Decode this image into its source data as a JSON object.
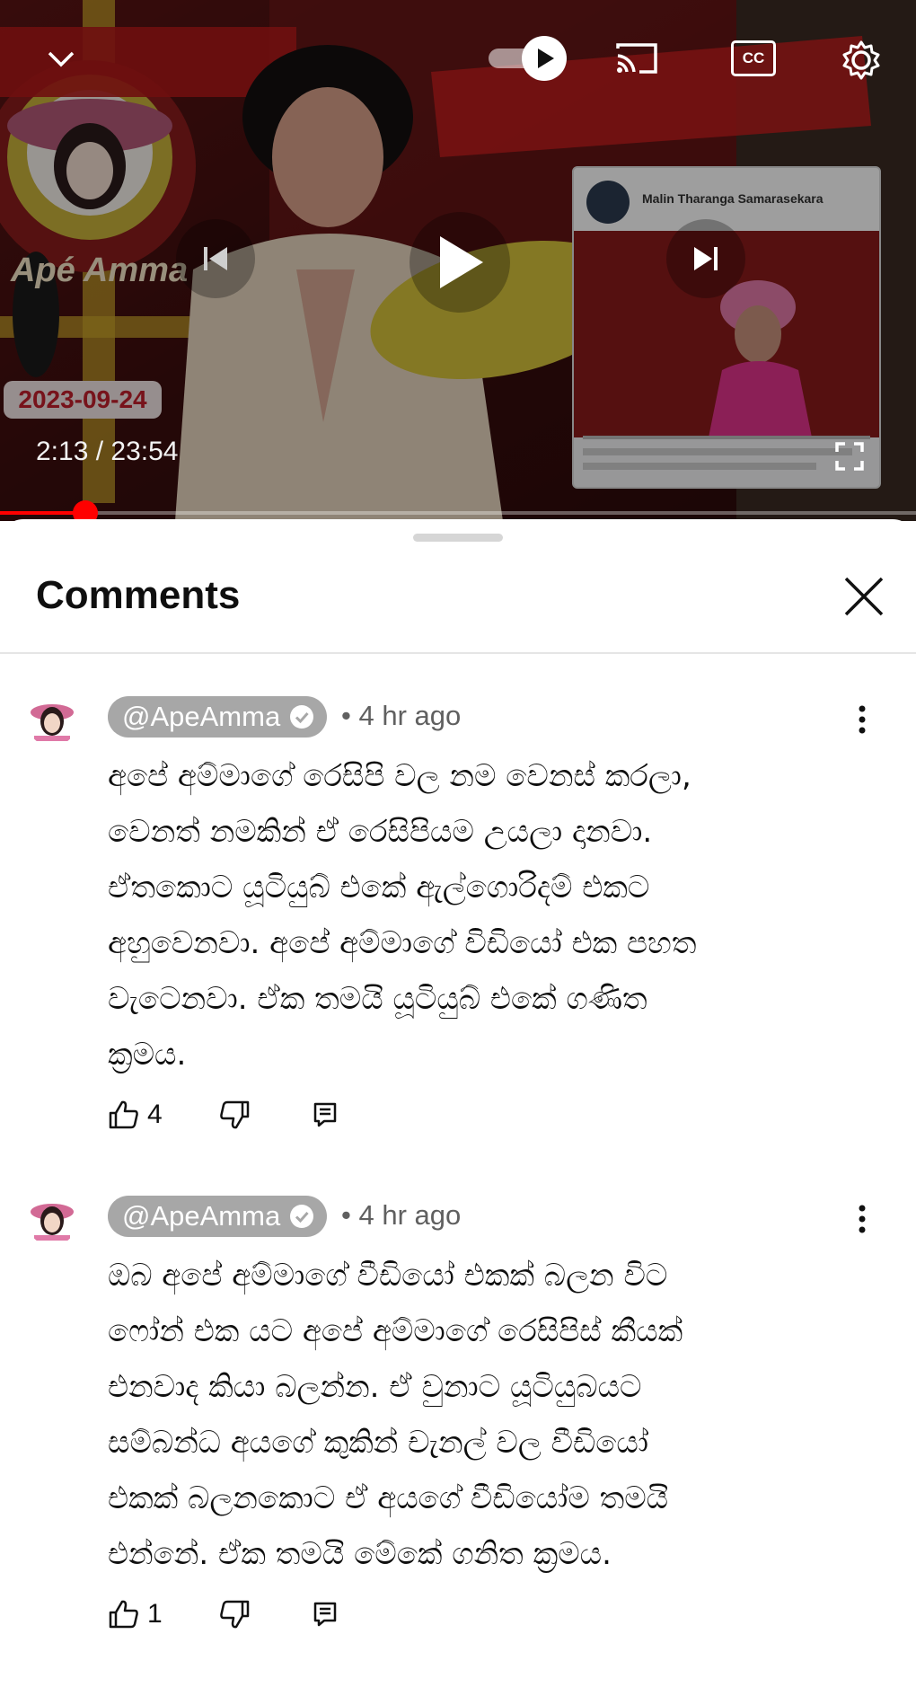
{
  "player": {
    "current_time": "2:13",
    "duration": "23:54",
    "time_separator": " / ",
    "progress_fraction": 0.093,
    "thumbnail": {
      "channel_brand": "Apé Amma",
      "date_badge": "2023-09-24",
      "card_name": "Malin Tharanga Samarasekara"
    },
    "icons": {
      "minimize": "chevron-down-icon",
      "autoplay": "autoplay-toggle-icon",
      "cast": "cast-icon",
      "captions": "cc-icon",
      "settings": "gear-icon",
      "previous": "previous-icon",
      "play": "play-icon",
      "next": "next-icon",
      "fullscreen": "fullscreen-icon"
    },
    "cc_label": "CC"
  },
  "comments_panel": {
    "title": "Comments",
    "close_icon": "close-icon"
  },
  "comments": [
    {
      "author": "@ApeAmma",
      "verified": true,
      "separator": "•",
      "time": "4 hr ago",
      "lines": [
        "අපේ අම්මාගේ රෙසිපි වල නම වෙනස් කරලා,",
        "වෙනත් නමකින් ඒ රෙසිපියම උයලා දානවා.",
        "ඒතකොට යූටියුබ් එකේ ඇල්ගොරිදම් එකට",
        "අහුවෙනවා. අපේ අම්මාගේ විඩියෝ එක පහත",
        "වැටෙනවා. ඒක තමයි යූටියුබ් එකේ ගණිත",
        "ක්‍රමය."
      ],
      "likes": "4"
    },
    {
      "author": "@ApeAmma",
      "verified": true,
      "separator": "•",
      "time": "4 hr ago",
      "lines": [
        "ඔබ අපේ අම්මාගේ වීඩියෝ එකක් බලන විට",
        "ෆෝන් එක යට අපේ අම්මාගේ රෙසිපිස් කීයක්",
        "එනවාද කියා බලන්න. ඒ වුනාට යූටියුබයට",
        "සම්බන්ධ අයගේ කුකින් චැනල් වල වීඩියෝ",
        "එකක් බලනකොට ඒ අයගේ වීඩියෝම තමයි",
        "එන්නේ. ඒක තමයි මේකේ ගනිත ක්‍රමය."
      ],
      "likes": "1"
    }
  ],
  "colors": {
    "progress": "#ff0000",
    "author_chip": "#a7a7a7",
    "meta_text": "#606060"
  }
}
